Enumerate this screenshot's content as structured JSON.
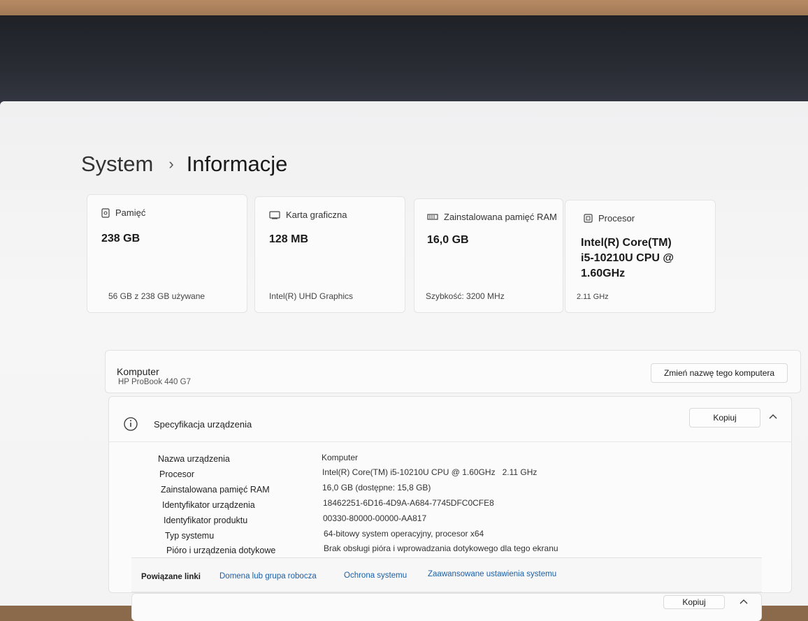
{
  "breadcrumb": {
    "root": "System",
    "separator": "›",
    "current": "Informacje"
  },
  "cards": [
    {
      "title": "Pamięć",
      "icon": "storage-icon",
      "value": "238 GB",
      "sub": "56 GB z 238 GB używane"
    },
    {
      "title": "Karta graficzna",
      "icon": "gpu-icon",
      "value": "128 MB",
      "sub": "Intel(R) UHD Graphics"
    },
    {
      "title": "Zainstalowana pamięć RAM",
      "icon": "ram-icon",
      "value": "16,0 GB",
      "sub": "Szybkość: 3200 MHz"
    },
    {
      "title": "Procesor",
      "icon": "cpu-icon",
      "value_lines": [
        "Intel(R) Core(TM)",
        "i5-10210U CPU @",
        "1.60GHz"
      ],
      "sub": "2.11 GHz"
    }
  ],
  "computer": {
    "label": "Komputer",
    "model": "HP ProBook 440 G7",
    "rename_button": "Zmień nazwę tego komputera"
  },
  "spec": {
    "title": "Specyfikacja urządzenia",
    "copy_button": "Kopiuj",
    "rows": [
      {
        "label": "Nazwa urządzenia",
        "value": "Komputer"
      },
      {
        "label": "Procesor",
        "value": "Intel(R) Core(TM) i5-10210U CPU @ 1.60GHz   2.11 GHz"
      },
      {
        "label": "Zainstalowana pamięć RAM",
        "value": "16,0 GB (dostępne: 15,8 GB)"
      },
      {
        "label": "Identyfikator urządzenia",
        "value": "18462251-6D16-4D9A-A684-7745DFC0CFE8"
      },
      {
        "label": "Identyfikator produktu",
        "value": "00330-80000-00000-AA817"
      },
      {
        "label": "Typ systemu",
        "value": "64-bitowy system operacyjny, procesor x64"
      },
      {
        "label": "Pióro i urządzenia dotykowe",
        "value": "Brak obsługi pióra i wprowadzania dotykowego dla tego ekranu"
      }
    ]
  },
  "related": {
    "label": "Powiązane linki",
    "links": [
      "Domena lub grupa robocza",
      "Ochrona systemu",
      "Zaawansowane ustawienia systemu"
    ]
  },
  "bottom_copy_button": "Kopiuj"
}
